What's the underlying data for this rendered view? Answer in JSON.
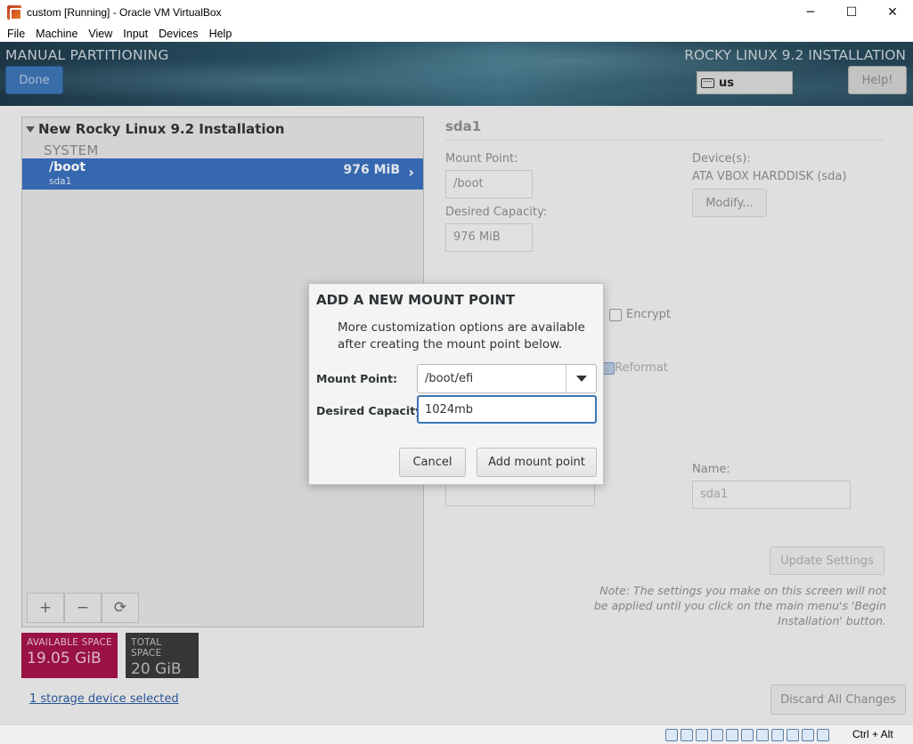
{
  "window": {
    "title": "custom [Running] - Oracle VM VirtualBox",
    "controls": {
      "minimize": "─",
      "maximize": "☐",
      "close": "✕"
    }
  },
  "menu": [
    "File",
    "Machine",
    "View",
    "Input",
    "Devices",
    "Help"
  ],
  "header": {
    "page_title": "MANUAL PARTITIONING",
    "product_title": "ROCKY LINUX 9.2 INSTALLATION",
    "done_label": "Done",
    "keyboard_layout": "us",
    "help_label": "Help!"
  },
  "left_panel": {
    "install_label": "New Rocky Linux 9.2 Installation",
    "system_label": "SYSTEM",
    "mount_points": [
      {
        "mount": "/boot",
        "device": "sda1",
        "size": "976 MiB"
      }
    ],
    "tools": {
      "add": "+",
      "remove": "−",
      "refresh": "⟳"
    }
  },
  "space": {
    "available_label": "AVAILABLE SPACE",
    "available_value": "19.05 GiB",
    "total_label": "TOTAL SPACE",
    "total_value": "20 GiB"
  },
  "storage_link": "1 storage device selected",
  "detail": {
    "title": "sda1",
    "mount_point_label": "Mount Point:",
    "mount_point_value": "/boot",
    "capacity_label": "Desired Capacity:",
    "capacity_value": "976 MiB",
    "devices_label": "Device(s):",
    "devices_value": "ATA VBOX HARDDISK (sda)",
    "modify_label": "Modify...",
    "encrypt_label": "Encrypt",
    "reformat_label": "Reformat",
    "name_label": "Name:",
    "name_value": "sda1",
    "update_label": "Update Settings",
    "note": "Note:  The settings you make on this screen will not be applied until you click on the main menu's 'Begin Installation' button."
  },
  "discard_label": "Discard All Changes",
  "dialog": {
    "title": "ADD A NEW MOUNT POINT",
    "description": "More customization options are available after creating the mount point below.",
    "mount_point_label": "Mount Point:",
    "mount_point_value": "/boot/efi",
    "capacity_label": "Desired Capacity:",
    "capacity_value": "1024mb",
    "cancel_label": "Cancel",
    "add_label": "Add mount point"
  },
  "statusbar": {
    "host_key": "Ctrl + Alt"
  },
  "colors": {
    "accent": "#3a6fbb",
    "available": "#a3134a",
    "total": "#3a3a3a"
  }
}
